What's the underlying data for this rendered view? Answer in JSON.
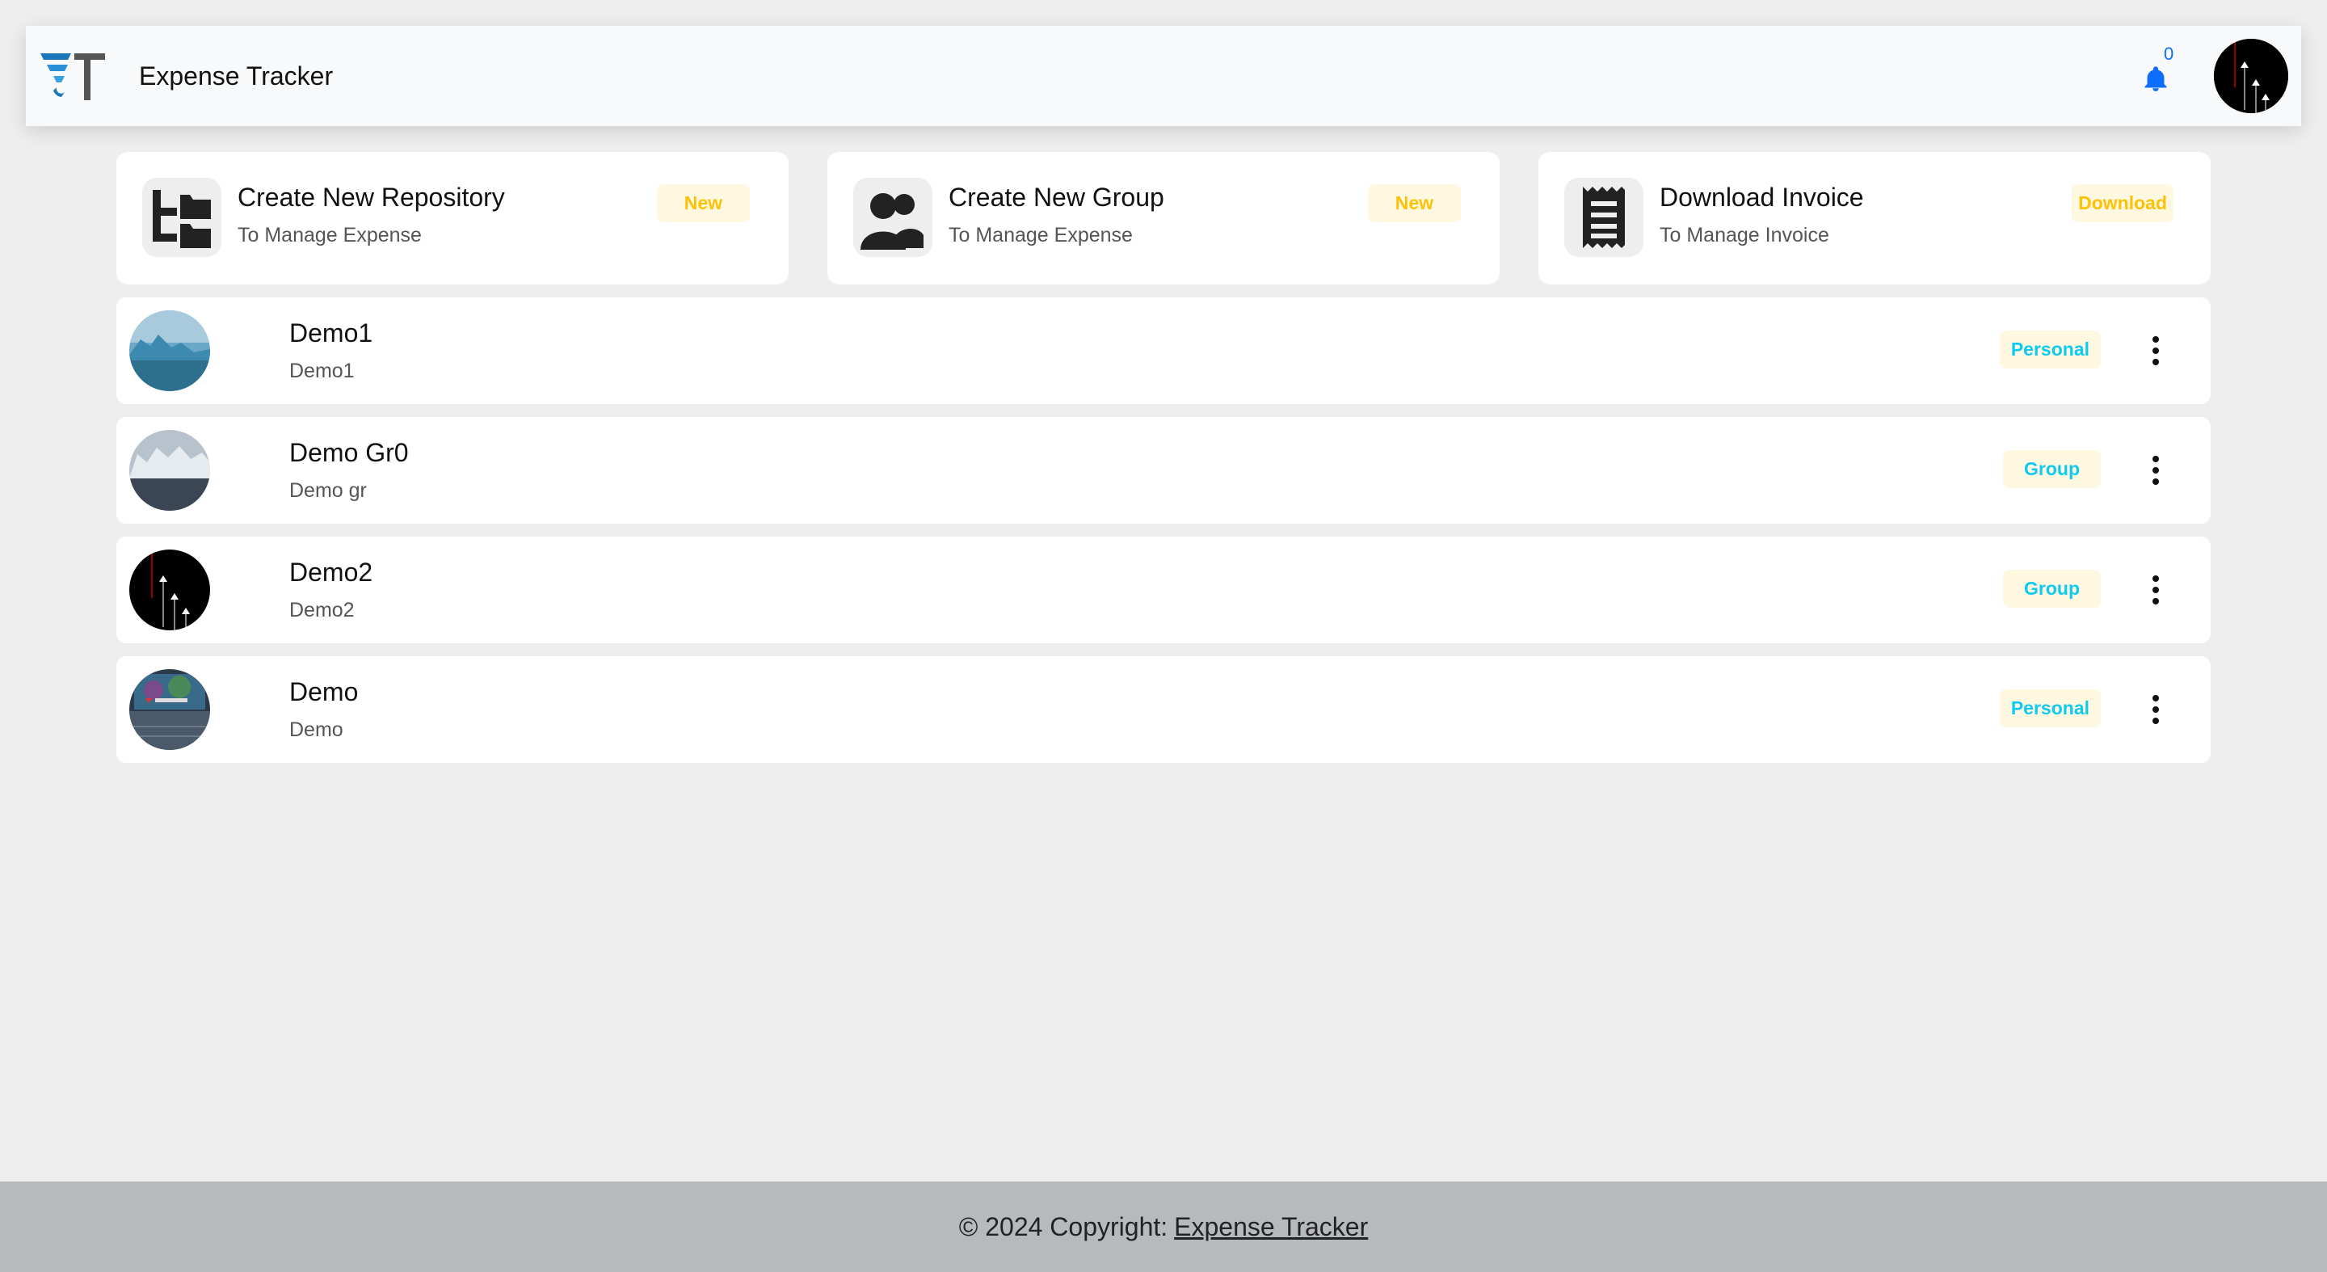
{
  "navbar": {
    "brand_name": "Expense Tracker",
    "notification_count": "0",
    "logo_icon": "expense-tracker-logo",
    "bell_icon": "bell-icon",
    "accent_color": "#0d6efd"
  },
  "cards": [
    {
      "title": "Create New Repository",
      "subtitle": "To Manage Expense",
      "badge": "New",
      "icon": "folder-tree-icon"
    },
    {
      "title": "Create New Group",
      "subtitle": "To Manage Expense",
      "badge": "New",
      "icon": "users-icon"
    },
    {
      "title": "Download Invoice",
      "subtitle": "To Manage Invoice",
      "badge": "Download",
      "icon": "receipt-icon"
    }
  ],
  "repositories": [
    {
      "title": "Demo1",
      "subtitle": "Demo1",
      "type": "Personal",
      "avatar": "iceberg-image"
    },
    {
      "title": "Demo Gr0",
      "subtitle": "Demo gr",
      "type": "Group",
      "avatar": "glacier-image"
    },
    {
      "title": "Demo2",
      "subtitle": "Demo2",
      "type": "Group",
      "avatar": "planes-image"
    },
    {
      "title": "Demo",
      "subtitle": "Demo",
      "type": "Personal",
      "avatar": "victus-laptop-image"
    }
  ],
  "footer": {
    "prefix": "© 2024 Copyright:",
    "link": "Expense Tracker"
  },
  "colors": {
    "badge_bg": "#fff8e1",
    "card_badge_text": "#ffc107",
    "row_badge_text": "#0dcaf0",
    "footer_bg": "#b7babc",
    "page_bg": "#eeeeee"
  }
}
